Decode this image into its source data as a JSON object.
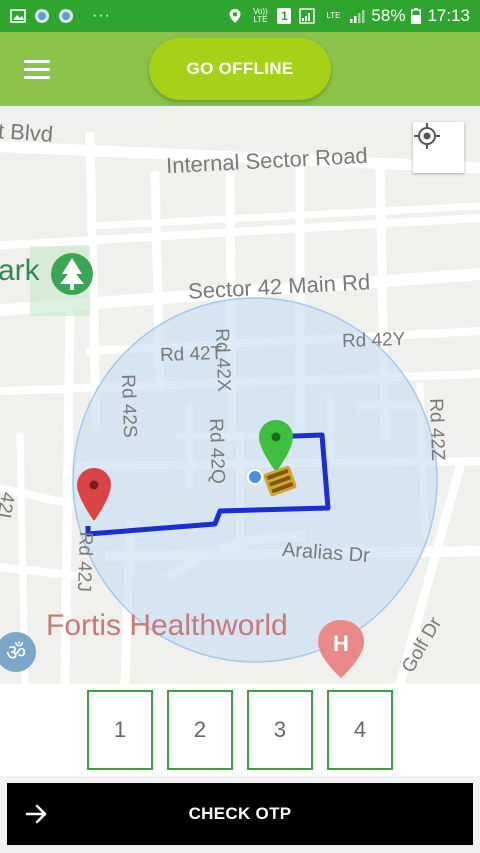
{
  "status_bar": {
    "notifications": [
      "gallery-icon",
      "app-icon-1",
      "app-icon-2"
    ],
    "dots": "···",
    "volte": "Vo)) LTE",
    "sim": "1",
    "lte": "LTE",
    "battery": "58%",
    "time": "17:13"
  },
  "app_bar": {
    "menu_icon": "hamburger-icon",
    "offline_label": "GO OFFLINE"
  },
  "map": {
    "roads": {
      "blvd": "t Blvd",
      "internal": "Internal Sector Road",
      "sector42": "Sector 42 Main Rd",
      "rd42t": "Rd 42T",
      "rd42x": "Rd 42X",
      "rd42y": "Rd 42Y",
      "rd42s": "Rd 42S",
      "rd42q": "Rd 42Q",
      "rd42z": "Rd 42Z",
      "rd42l": "42L",
      "rd42j": "Rd 42J",
      "aralias": "Aralias Dr",
      "golf": "Golf Dr"
    },
    "park_label": "ark",
    "poi_label": "Fortis Healthworld",
    "hospital_glyph": "H",
    "om_glyph": "ॐ",
    "colors": {
      "route": "#1a2fd1",
      "radius_fill": "#c9dff5",
      "origin_marker": "#d94545",
      "dest_marker": "#3fbf3f"
    }
  },
  "otp": {
    "digits": [
      "1",
      "2",
      "3",
      "4"
    ]
  },
  "check_otp": {
    "label": "CHECK OTP"
  }
}
